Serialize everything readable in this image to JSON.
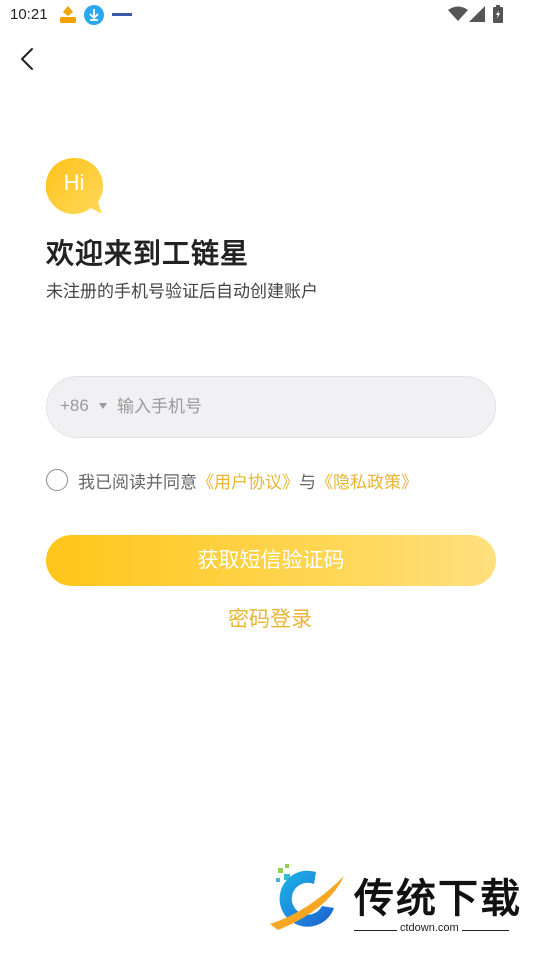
{
  "status_bar": {
    "time": "10:21"
  },
  "header": {
    "back_icon": "chevron-left-icon"
  },
  "welcome": {
    "badge": "Hi",
    "title": "欢迎来到工链星",
    "subtitle": "未注册的手机号验证后自动创建账户"
  },
  "phone": {
    "country_code": "+86",
    "placeholder": "输入手机号",
    "value": ""
  },
  "agreement": {
    "prefix": "我已阅读并同意",
    "user_agreement": "《用户协议》",
    "joiner": "与",
    "privacy_policy": "《隐私政策》",
    "checked": false
  },
  "actions": {
    "sms_button": "获取短信验证码",
    "password_login": "密码登录"
  },
  "watermark": {
    "title": "传统下载",
    "url": "ctdown.com"
  },
  "colors": {
    "accent": "#e8b536",
    "button_start": "#ffc61a",
    "button_end": "#ffe07e",
    "input_bg": "#f1f1f3"
  }
}
